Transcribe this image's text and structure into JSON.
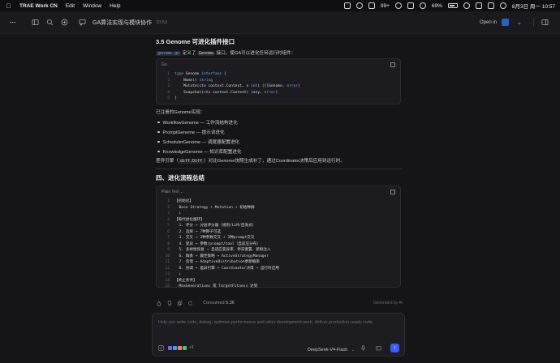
{
  "menubar": {
    "items": [
      "TRAE Work CN",
      "Edit",
      "Window",
      "Help"
    ],
    "notifications": "99+",
    "battery": "69%",
    "datetime": "8月3日 周一  10:57"
  },
  "titlebar": {
    "tab_title": "GA算法实现与模块协作",
    "tab_time": "10:53",
    "open_in": "Open in"
  },
  "doc": {
    "h3": "3.5 Genome 可进化插件接口",
    "intro_file": "genome.go",
    "intro_mid": " 定义了 ",
    "intro_code": "Genome",
    "intro_end": " 接口，使GA可以进化任何运行时组件：",
    "code1": {
      "lang": "Go",
      "lines": [
        {
          "n": "1",
          "html": "<span class=\"kw\">type</span> Genome <span class=\"kw\">interface</span> {"
        },
        {
          "n": "2",
          "html": "    Name() <span class=\"kw\">string</span>"
        },
        {
          "n": "3",
          "html": "    Mutate(ctx context.Context, n <span class=\"kw\">int</span>) ([]Genome, <span class=\"kw\">error</span>)"
        },
        {
          "n": "4",
          "html": "    Snapshot(ctx context.Context) (any, <span class=\"kw\">error</span>)"
        },
        {
          "n": "5",
          "html": "}"
        }
      ]
    },
    "registered": "已注册的Genome实现：",
    "bullets": [
      "WorkflowGenome — 工作流结构进化",
      "PromptGenome — 提示词进化",
      "SchedulerGenome — 调度器配置进化",
      "KnowledgeGenome — 知识库配置进化"
    ],
    "diff_pre": "差异引擎（",
    "diff_code": "diff.Diff",
    "diff_post": "）对比Genome快照生成补丁，通过Coordinator决策后应用到运行时。",
    "h2": "四、进化流程总结",
    "code2": {
      "lang": "Plain Text",
      "lines": [
        {
          "n": "1",
          "t": "【初始化】"
        },
        {
          "n": "2",
          "t": "  Base Strategy + Mutation → 初始种群"
        },
        {
          "n": "3",
          "t": "  ↓"
        },
        {
          "n": "4",
          "t": "【每代进化循环】"
        },
        {
          "n": "5",
          "t": "  1. 评分 → 分层评分器（规则/LLM/启发式）"
        },
        {
          "n": "6",
          "t": "  2. 选择 → 7种算子可选"
        },
        {
          "n": "7",
          "t": "  3. 交叉 → 3种参数交叉 + 3种prompt交叉"
        },
        {
          "n": "8",
          "t": "  4. 变异 → 参数/prompt/tool（自适应分布）"
        },
        {
          "n": "9",
          "t": "  5. 多样性恢复 → 自适应变异率、停滞重置、新鲜注入"
        },
        {
          "n": "10",
          "t": "  6. 群奏 → 最佳策略 → ActiveStrategyManager"
        },
        {
          "n": "11",
          "t": "  7. 反馈 → AdaptiveDistribution更新概率"
        },
        {
          "n": "12",
          "t": "  8. 协调 → 差异引擎 + Coordinator决策 → 运行时应用"
        },
        {
          "n": "13",
          "t": "  ↓"
        },
        {
          "n": "14",
          "t": "【终止条件】"
        },
        {
          "n": "15",
          "t": "  MaxGenerations 或 TargetFitness 达到"
        }
      ]
    }
  },
  "footer": {
    "consumed_label": "Consumed",
    "consumed_value": "5.36",
    "generated": "Generated by AI"
  },
  "input": {
    "placeholder": "Help you write code, debug, optimize performance and other development work, deliver production-ready code.",
    "plus_count": "+1",
    "model": "DeepSeek-V4-Flash"
  }
}
